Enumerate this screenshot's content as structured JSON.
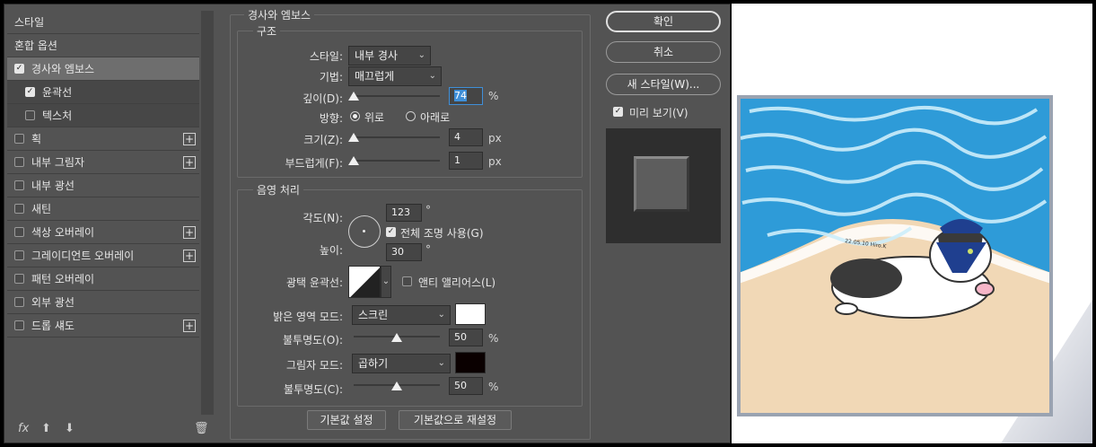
{
  "left_panel": {
    "items": [
      {
        "label": "스타일",
        "checkbox": false,
        "checked": false,
        "plus": false
      },
      {
        "label": "혼합 옵션",
        "checkbox": false,
        "checked": false,
        "plus": false
      },
      {
        "label": "경사와 엠보스",
        "checkbox": true,
        "checked": true,
        "plus": false
      },
      {
        "label": "윤곽선",
        "checkbox": true,
        "checked": true,
        "plus": false
      },
      {
        "label": "텍스처",
        "checkbox": true,
        "checked": false,
        "plus": false
      },
      {
        "label": "획",
        "checkbox": true,
        "checked": false,
        "plus": true
      },
      {
        "label": "내부 그림자",
        "checkbox": true,
        "checked": false,
        "plus": true
      },
      {
        "label": "내부 광선",
        "checkbox": true,
        "checked": false,
        "plus": false
      },
      {
        "label": "새틴",
        "checkbox": true,
        "checked": false,
        "plus": false
      },
      {
        "label": "색상 오버레이",
        "checkbox": true,
        "checked": false,
        "plus": true
      },
      {
        "label": "그레이디언트 오버레이",
        "checkbox": true,
        "checked": false,
        "plus": true
      },
      {
        "label": "패턴 오버레이",
        "checkbox": true,
        "checked": false,
        "plus": false
      },
      {
        "label": "외부 광선",
        "checkbox": true,
        "checked": false,
        "plus": false
      },
      {
        "label": "드롭 섀도",
        "checkbox": true,
        "checked": false,
        "plus": true
      }
    ],
    "fx_label": "fx"
  },
  "main": {
    "section_title": "경사와 엠보스",
    "structure": {
      "title": "구조",
      "style_label": "스타일:",
      "style_value": "내부 경사",
      "technique_label": "기법:",
      "technique_value": "매끄럽게",
      "depth_label": "깊이(D):",
      "depth_value": "74",
      "depth_unit": "%",
      "direction_label": "방향:",
      "direction_up": "위로",
      "direction_down": "아래로",
      "size_label": "크기(Z):",
      "size_value": "4",
      "size_unit": "px",
      "soften_label": "부드럽게(F):",
      "soften_value": "1",
      "soften_unit": "px"
    },
    "shading": {
      "title": "음영 처리",
      "angle_label": "각도(N):",
      "angle_value": "123",
      "angle_unit": "°",
      "global_light_label": "전체 조명 사용(G)",
      "altitude_label": "높이:",
      "altitude_value": "30",
      "altitude_unit": "°",
      "gloss_label": "광택 윤곽선:",
      "anti_alias_label": "앤티 앨리어스(L)",
      "highlight_mode_label": "밝은 영역 모드:",
      "highlight_mode_value": "스크린",
      "highlight_color": "#ffffff",
      "highlight_opacity_label": "불투명도(O):",
      "highlight_opacity_value": "50",
      "highlight_opacity_unit": "%",
      "shadow_mode_label": "그림자 모드:",
      "shadow_mode_value": "곱하기",
      "shadow_color": "#0a0000",
      "shadow_opacity_label": "불투명도(C):",
      "shadow_opacity_value": "50",
      "shadow_opacity_unit": "%"
    },
    "default_button": "기본값 설정",
    "reset_button": "기본값으로 재설정"
  },
  "right": {
    "ok_button": "확인",
    "cancel_button": "취소",
    "new_style_button": "새 스타일(W)...",
    "preview_label": "미리 보기(V)"
  },
  "sliders": {
    "depth_fraction": 0.0,
    "size_fraction": 0.0,
    "soften_fraction": 0.0,
    "highlight_opacity_fraction": 0.5,
    "shadow_opacity_fraction": 0.5
  },
  "canvas_text": "22.05.10 Hiro.K"
}
